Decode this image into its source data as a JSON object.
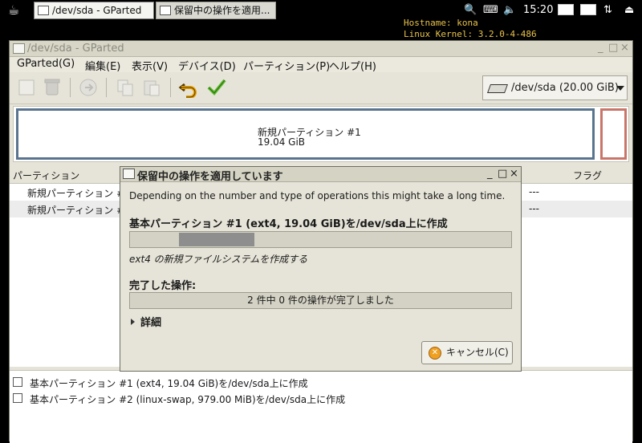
{
  "taskbar": {
    "menu_icon": "teacup-icon",
    "tasks": [
      {
        "label": "/dev/sda - GParted",
        "icon": "gparted-icon",
        "active": true
      },
      {
        "label": "保留中の操作を適用...",
        "icon": "gparted-icon",
        "active": false
      }
    ],
    "clock": "15:20",
    "tray_icons": [
      "search-icon",
      "keyboard-icon",
      "network-icon",
      "volume-icon",
      "window-icon",
      "window-icon",
      "logout-icon"
    ]
  },
  "desktop_info": {
    "hostname": "Hostname: kona",
    "kernel": "Linux Kernel: 3.2.0-4-486"
  },
  "window": {
    "title": "/dev/sda - GParted",
    "controls": [
      "_",
      "□",
      "×"
    ],
    "menu": [
      "GParted(G)",
      "編集(E)",
      "表示(V)",
      "デバイス(D)",
      "パーティション(P)",
      "ヘルプ(H)"
    ],
    "toolbar": {
      "buttons": [
        {
          "name": "new-icon",
          "enabled": false
        },
        {
          "name": "delete-icon",
          "enabled": false
        },
        {
          "name": "resize-icon",
          "enabled": false
        },
        {
          "name": "copy-icon",
          "enabled": false
        },
        {
          "name": "paste-icon",
          "enabled": false
        },
        {
          "name": "undo-icon",
          "enabled": true
        },
        {
          "name": "apply-icon",
          "enabled": true
        }
      ],
      "device_select": "/dev/sda  (20.00 GiB)"
    },
    "partition_visual": {
      "main_name": "新規パーティション #1",
      "main_size": "19.04 GiB",
      "main_color": "#59748f",
      "swap_color": "#c9766a"
    },
    "list": {
      "columns": [
        "パーティション",
        "フラグ"
      ],
      "rows": [
        {
          "name": "新規パーティション #1",
          "flags": "---"
        },
        {
          "name": "新規パーティション #2",
          "flags": "---"
        }
      ]
    },
    "pending_ops": [
      "基本パーティション #1 (ext4, 19.04 GiB)を/dev/sda上に作成",
      "基本パーティション #2 (linux-swap, 979.00 MiB)を/dev/sda上に作成"
    ]
  },
  "dialog": {
    "title": "保留中の操作を適用しています",
    "controls": [
      "_",
      "□",
      "×"
    ],
    "description": "Depending on the number and type of operations this might take a long time.",
    "current_op": "基本パーティション #1 (ext4, 19.04 GiB)を/dev/sda上に作成",
    "sub_status": "ext4 の新規ファイルシステムを作成する",
    "completed_label": "完了した操作:",
    "completed_progress": "2 件中 0 件の操作が完了しました",
    "details_label": "詳細",
    "cancel_label": "キャンセル(C)"
  }
}
